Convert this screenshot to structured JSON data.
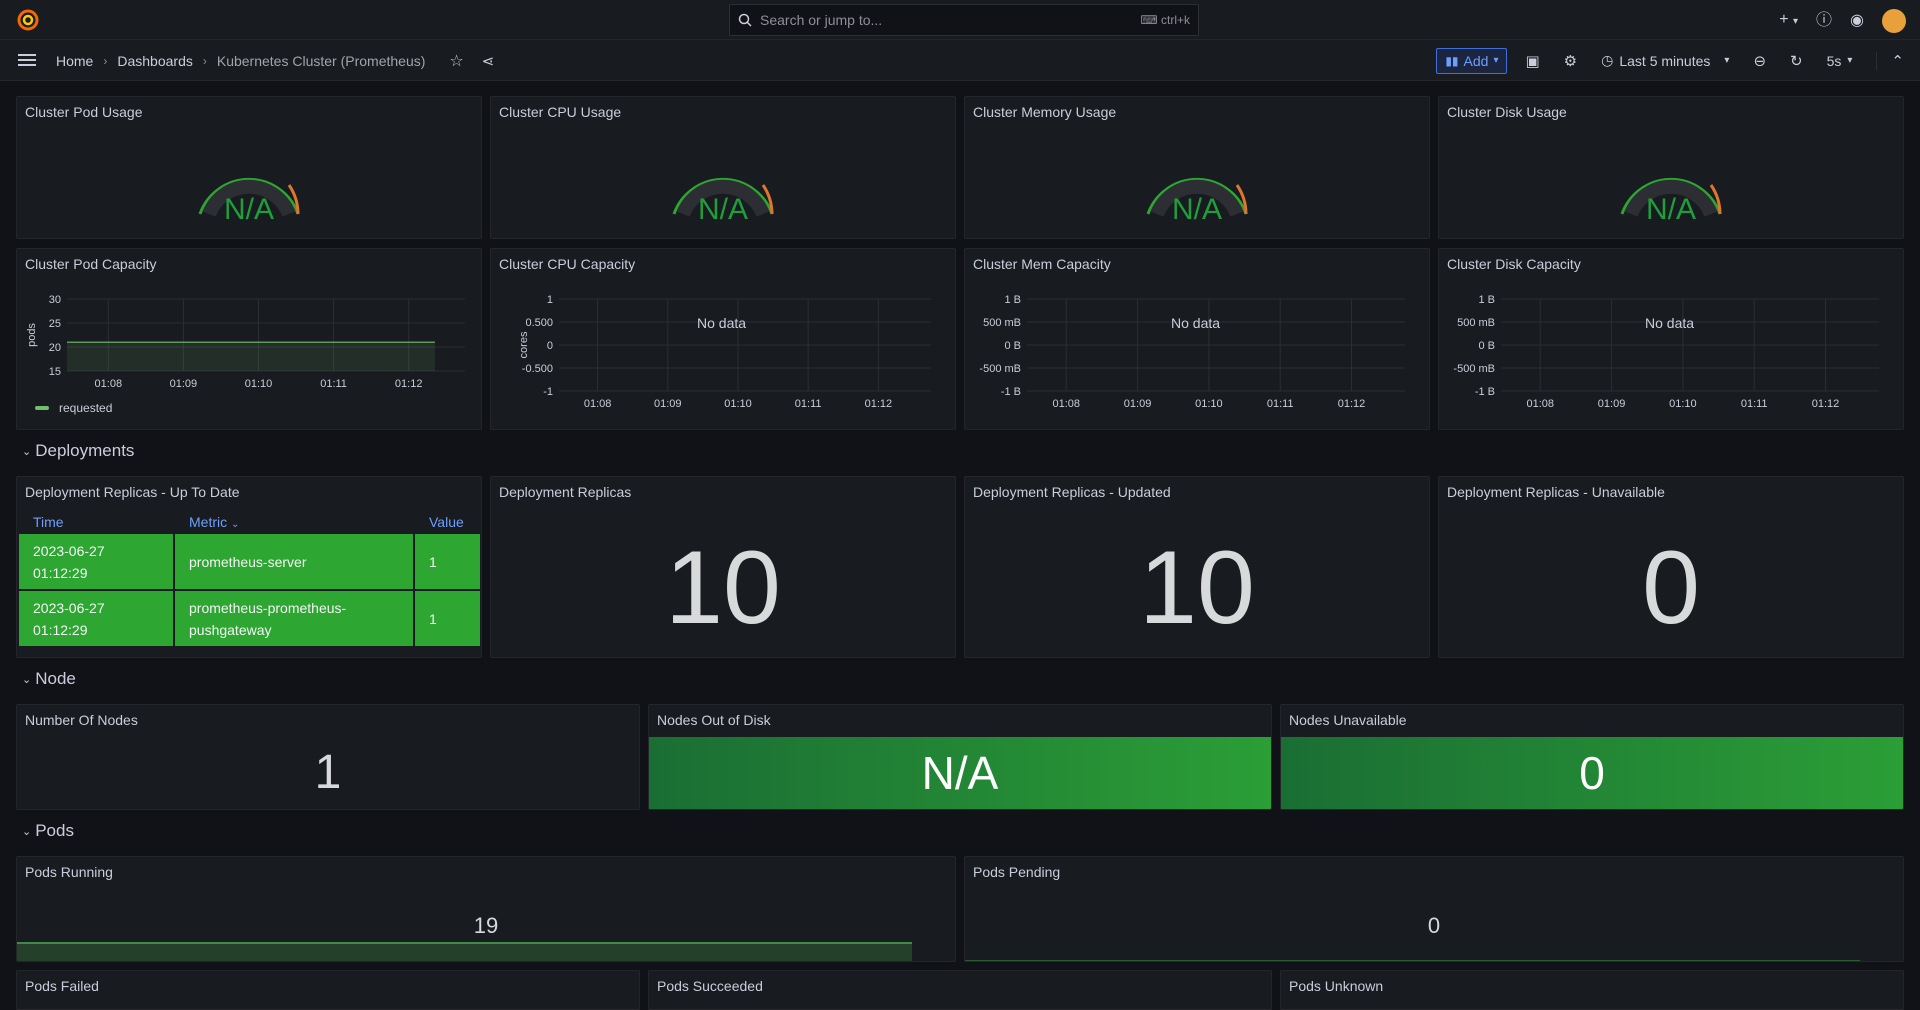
{
  "topbar": {
    "search_placeholder": "Search or jump to...",
    "search_shortcut": "ctrl+k"
  },
  "navbar": {
    "breadcrumbs": [
      "Home",
      "Dashboards",
      "Kubernetes Cluster (Prometheus)"
    ],
    "add_label": "Add",
    "time_range": "Last 5 minutes",
    "refresh_interval": "5s"
  },
  "gauges": [
    {
      "title": "Cluster Pod Usage",
      "value": "N/A"
    },
    {
      "title": "Cluster CPU Usage",
      "value": "N/A"
    },
    {
      "title": "Cluster Memory Usage",
      "value": "N/A"
    },
    {
      "title": "Cluster Disk Usage",
      "value": "N/A"
    }
  ],
  "capacity": {
    "pod_title": "Cluster Pod Capacity",
    "cpu_title": "Cluster CPU Capacity",
    "mem_title": "Cluster Mem Capacity",
    "disk_title": "Cluster Disk Capacity",
    "no_data": "No data",
    "legend_requested": "requested",
    "pod_ylabel": "pods",
    "cpu_ylabel": "cores",
    "x_ticks": [
      "01:08",
      "01:09",
      "01:10",
      "01:11",
      "01:12"
    ],
    "pod_y_ticks": [
      "30",
      "25",
      "20",
      "15"
    ],
    "cpu_y_ticks": [
      "1",
      "0.500",
      "0",
      "-0.500",
      "-1"
    ],
    "bytes_y_ticks": [
      "1 B",
      "500 mB",
      "0 B",
      "-500 mB",
      "-1 B"
    ]
  },
  "chart_data": {
    "type": "line",
    "title": "Cluster Pod Capacity",
    "ylabel": "pods",
    "x": [
      "01:08",
      "01:09",
      "01:10",
      "01:11",
      "01:12"
    ],
    "ylim": [
      15,
      30
    ],
    "series": [
      {
        "name": "requested",
        "values": [
          21,
          21,
          21,
          21,
          21
        ]
      }
    ]
  },
  "rows": {
    "deployments": "Deployments",
    "node": "Node",
    "pods": "Pods"
  },
  "deployments": {
    "table_title": "Deployment Replicas - Up To Date",
    "columns": [
      "Time",
      "Metric",
      "Value"
    ],
    "rows": [
      {
        "time_date": "2023-06-27",
        "time_clock": "01:12:29",
        "metric_1": "prometheus-server",
        "metric_2": "",
        "value": "1"
      },
      {
        "time_date": "2023-06-27",
        "time_clock": "01:12:29",
        "metric_1": "prometheus-prometheus-",
        "metric_2": "pushgateway",
        "value": "1"
      }
    ],
    "replicas_title": "Deployment Replicas",
    "replicas_value": "10",
    "updated_title": "Deployment Replicas - Updated",
    "updated_value": "10",
    "unavailable_title": "Deployment Replicas - Unavailable",
    "unavailable_value": "0"
  },
  "node": {
    "nodes_title": "Number Of Nodes",
    "nodes_value": "1",
    "outdisk_title": "Nodes Out of Disk",
    "outdisk_value": "N/A",
    "unavail_title": "Nodes Unavailable",
    "unavail_value": "0"
  },
  "pods": {
    "running_title": "Pods Running",
    "running_value": "19",
    "pending_title": "Pods Pending",
    "pending_value": "0",
    "failed_title": "Pods Failed",
    "succeeded_title": "Pods Succeeded",
    "unknown_title": "Pods Unknown"
  },
  "colors": {
    "ok": "#2ea632",
    "warn": "#e0752d",
    "accent": "#6e9fff"
  }
}
